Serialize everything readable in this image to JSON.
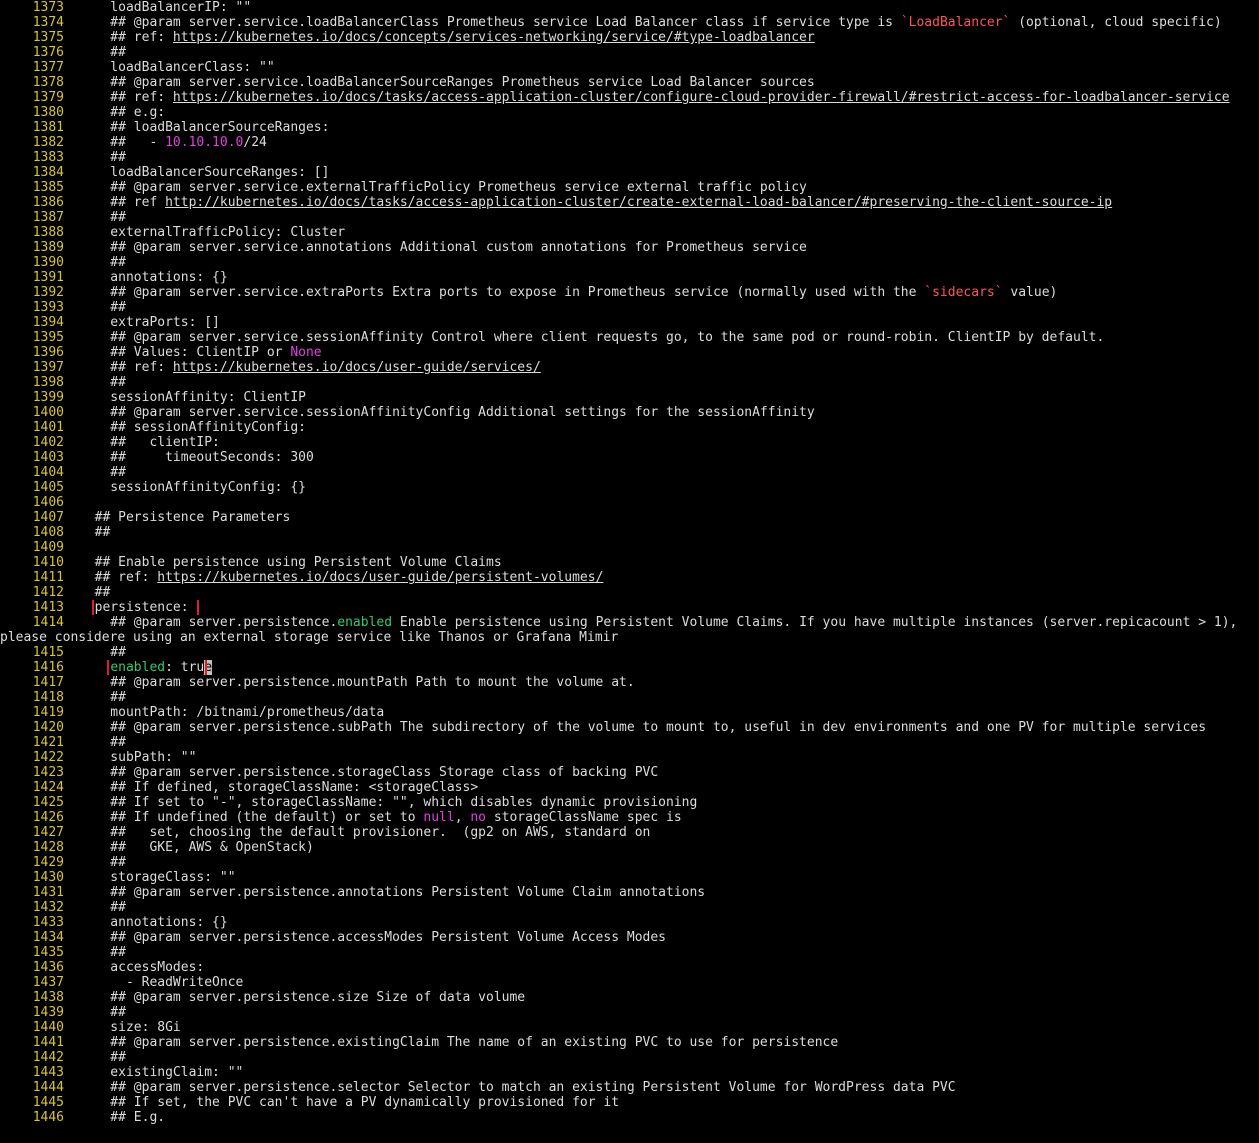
{
  "lines": [
    {
      "n": "1373",
      "segs": [
        {
          "t": "    loadBalancerIP: \"\""
        }
      ]
    },
    {
      "n": "1374",
      "segs": [
        {
          "t": "    ## @param server.service.loadBalancerClass Prometheus service Load Balancer class if service type is "
        },
        {
          "t": "`LoadBalancer`",
          "c": "redstr"
        },
        {
          "t": " (optional, cloud specific)"
        }
      ]
    },
    {
      "n": "1375",
      "segs": [
        {
          "t": "    ## ref: "
        },
        {
          "t": "https://kubernetes.io/docs/concepts/services-networking/service/#type-loadbalancer",
          "c": "link"
        }
      ]
    },
    {
      "n": "1376",
      "segs": [
        {
          "t": "    ##"
        }
      ]
    },
    {
      "n": "1377",
      "segs": [
        {
          "t": "    loadBalancerClass: \"\""
        }
      ]
    },
    {
      "n": "1378",
      "segs": [
        {
          "t": "    ## @param server.service.loadBalancerSourceRanges Prometheus service Load Balancer sources"
        }
      ]
    },
    {
      "n": "1379",
      "segs": [
        {
          "t": "    ## ref: "
        },
        {
          "t": "https://kubernetes.io/docs/tasks/access-application-cluster/configure-cloud-provider-firewall/#restrict-access-for-loadbalancer-service",
          "c": "link"
        }
      ]
    },
    {
      "n": "1380",
      "segs": [
        {
          "t": "    ## e.g:"
        }
      ]
    },
    {
      "n": "1381",
      "segs": [
        {
          "t": "    ## loadBalancerSourceRanges:"
        }
      ]
    },
    {
      "n": "1382",
      "segs": [
        {
          "t": "    ##   - "
        },
        {
          "t": "10.10.10.0",
          "c": "magenta"
        },
        {
          "t": "/24"
        }
      ]
    },
    {
      "n": "1383",
      "segs": [
        {
          "t": "    ##"
        }
      ]
    },
    {
      "n": "1384",
      "segs": [
        {
          "t": "    loadBalancerSourceRanges: []"
        }
      ]
    },
    {
      "n": "1385",
      "segs": [
        {
          "t": "    ## @param server.service.externalTrafficPolicy Prometheus service external traffic policy"
        }
      ]
    },
    {
      "n": "1386",
      "segs": [
        {
          "t": "    ## ref "
        },
        {
          "t": "http://kubernetes.io/docs/tasks/access-application-cluster/create-external-load-balancer/#preserving-the-client-source-ip",
          "c": "link"
        }
      ]
    },
    {
      "n": "1387",
      "segs": [
        {
          "t": "    ##"
        }
      ]
    },
    {
      "n": "1388",
      "segs": [
        {
          "t": "    externalTrafficPolicy: Cluster"
        }
      ]
    },
    {
      "n": "1389",
      "segs": [
        {
          "t": "    ## @param server.service.annotations Additional custom annotations for Prometheus service"
        }
      ]
    },
    {
      "n": "1390",
      "segs": [
        {
          "t": "    ##"
        }
      ]
    },
    {
      "n": "1391",
      "segs": [
        {
          "t": "    annotations: {}"
        }
      ]
    },
    {
      "n": "1392",
      "segs": [
        {
          "t": "    ## @param server.service.extraPorts Extra ports to expose in Prometheus service (normally used with the "
        },
        {
          "t": "`sidecars`",
          "c": "redstr"
        },
        {
          "t": " value)"
        }
      ]
    },
    {
      "n": "1393",
      "segs": [
        {
          "t": "    ##"
        }
      ]
    },
    {
      "n": "1394",
      "segs": [
        {
          "t": "    extraPorts: []"
        }
      ]
    },
    {
      "n": "1395",
      "segs": [
        {
          "t": "    ## @param server.service.sessionAffinity Control where client requests go, to the same pod or round-robin. ClientIP by default."
        }
      ]
    },
    {
      "n": "1396",
      "segs": [
        {
          "t": "    ## Values: ClientIP or "
        },
        {
          "t": "None",
          "c": "magenta"
        }
      ]
    },
    {
      "n": "1397",
      "segs": [
        {
          "t": "    ## ref: "
        },
        {
          "t": "https://kubernetes.io/docs/user-guide/services/",
          "c": "link"
        }
      ]
    },
    {
      "n": "1398",
      "segs": [
        {
          "t": "    ##"
        }
      ]
    },
    {
      "n": "1399",
      "segs": [
        {
          "t": "    sessionAffinity: ClientIP"
        }
      ]
    },
    {
      "n": "1400",
      "segs": [
        {
          "t": "    ## @param server.service.sessionAffinityConfig Additional settings for the sessionAffinity"
        }
      ]
    },
    {
      "n": "1401",
      "segs": [
        {
          "t": "    ## sessionAffinityConfig:"
        }
      ]
    },
    {
      "n": "1402",
      "segs": [
        {
          "t": "    ##   clientIP:"
        }
      ]
    },
    {
      "n": "1403",
      "segs": [
        {
          "t": "    ##     timeoutSeconds: 300"
        }
      ]
    },
    {
      "n": "1404",
      "segs": [
        {
          "t": "    ##"
        }
      ]
    },
    {
      "n": "1405",
      "segs": [
        {
          "t": "    sessionAffinityConfig: {}"
        }
      ]
    },
    {
      "n": "1406",
      "segs": [
        {
          "t": ""
        }
      ]
    },
    {
      "n": "1407",
      "segs": [
        {
          "t": "  ## Persistence Parameters"
        }
      ]
    },
    {
      "n": "1408",
      "segs": [
        {
          "t": "  ##"
        }
      ]
    },
    {
      "n": "1409",
      "segs": [
        {
          "t": ""
        }
      ]
    },
    {
      "n": "1410",
      "segs": [
        {
          "t": "  ## Enable persistence using Persistent Volume Claims"
        }
      ]
    },
    {
      "n": "1411",
      "segs": [
        {
          "t": "  ## ref: "
        },
        {
          "t": "https://kubernetes.io/docs/user-guide/persistent-volumes/",
          "c": "link"
        }
      ]
    },
    {
      "n": "1412",
      "segs": [
        {
          "t": "  ##"
        }
      ]
    },
    {
      "n": "1413",
      "segs": [
        {
          "t": "  "
        },
        {
          "t": "persistence: ",
          "c": "hl-box"
        }
      ]
    },
    {
      "n": "1414",
      "segs": [
        {
          "t": "    ## @param server.persistence."
        },
        {
          "t": "enabled",
          "c": "greenkey"
        },
        {
          "t": " Enable persistence using Persistent Volume Claims. If you have multiple instances (server.repicacount > 1),"
        }
      ]
    },
    {
      "n": "",
      "cont": true,
      "segs": [
        {
          "t": "please considere using an external storage service like Thanos or Grafana Mimir"
        }
      ]
    },
    {
      "n": "1415",
      "segs": [
        {
          "t": "    ##"
        }
      ]
    },
    {
      "n": "1416",
      "segs": [
        {
          "t": "    "
        },
        {
          "t": "enabled: tru",
          "c": "hl-box greenkey-start"
        },
        {
          "t": "e",
          "c": "cursor"
        }
      ]
    },
    {
      "n": "1417",
      "segs": [
        {
          "t": "    ## @param server.persistence.mountPath Path to mount the volume at."
        }
      ]
    },
    {
      "n": "1418",
      "segs": [
        {
          "t": "    ##"
        }
      ]
    },
    {
      "n": "1419",
      "segs": [
        {
          "t": "    mountPath: /bitnami/prometheus/data"
        }
      ]
    },
    {
      "n": "1420",
      "segs": [
        {
          "t": "    ## @param server.persistence.subPath The subdirectory of the volume to mount to, useful in dev environments and one PV for multiple services"
        }
      ]
    },
    {
      "n": "1421",
      "segs": [
        {
          "t": "    ##"
        }
      ]
    },
    {
      "n": "1422",
      "segs": [
        {
          "t": "    subPath: \"\""
        }
      ]
    },
    {
      "n": "1423",
      "segs": [
        {
          "t": "    ## @param server.persistence.storageClass Storage class of backing PVC"
        }
      ]
    },
    {
      "n": "1424",
      "segs": [
        {
          "t": "    ## If defined, storageClassName: <storageClass>"
        }
      ]
    },
    {
      "n": "1425",
      "segs": [
        {
          "t": "    ## If set to \"-\", storageClassName: \"\", which disables dynamic provisioning"
        }
      ]
    },
    {
      "n": "1426",
      "segs": [
        {
          "t": "    ## If undefined (the default) or set to "
        },
        {
          "t": "null",
          "c": "magenta"
        },
        {
          "t": ", "
        },
        {
          "t": "no",
          "c": "magenta"
        },
        {
          "t": " storageClassName spec is"
        }
      ]
    },
    {
      "n": "1427",
      "segs": [
        {
          "t": "    ##   set, choosing the default provisioner.  (gp2 on AWS, standard on"
        }
      ]
    },
    {
      "n": "1428",
      "segs": [
        {
          "t": "    ##   GKE, AWS & OpenStack)"
        }
      ]
    },
    {
      "n": "1429",
      "segs": [
        {
          "t": "    ##"
        }
      ]
    },
    {
      "n": "1430",
      "segs": [
        {
          "t": "    storageClass: \"\""
        }
      ]
    },
    {
      "n": "1431",
      "segs": [
        {
          "t": "    ## @param server.persistence.annotations Persistent Volume Claim annotations"
        }
      ]
    },
    {
      "n": "1432",
      "segs": [
        {
          "t": "    ##"
        }
      ]
    },
    {
      "n": "1433",
      "segs": [
        {
          "t": "    annotations: {}"
        }
      ]
    },
    {
      "n": "1434",
      "segs": [
        {
          "t": "    ## @param server.persistence.accessModes Persistent Volume Access Modes"
        }
      ]
    },
    {
      "n": "1435",
      "segs": [
        {
          "t": "    ##"
        }
      ]
    },
    {
      "n": "1436",
      "segs": [
        {
          "t": "    accessModes:"
        }
      ]
    },
    {
      "n": "1437",
      "segs": [
        {
          "t": "      - ReadWriteOnce"
        }
      ]
    },
    {
      "n": "1438",
      "segs": [
        {
          "t": "    ## @param server.persistence.size Size of data volume"
        }
      ]
    },
    {
      "n": "1439",
      "segs": [
        {
          "t": "    ##"
        }
      ]
    },
    {
      "n": "1440",
      "segs": [
        {
          "t": "    size: 8Gi"
        }
      ]
    },
    {
      "n": "1441",
      "segs": [
        {
          "t": "    ## @param server.persistence.existingClaim The name of an existing PVC to use for persistence"
        }
      ]
    },
    {
      "n": "1442",
      "segs": [
        {
          "t": "    ##"
        }
      ]
    },
    {
      "n": "1443",
      "segs": [
        {
          "t": "    existingClaim: \"\""
        }
      ]
    },
    {
      "n": "1444",
      "segs": [
        {
          "t": "    ## @param server.persistence.selector Selector to match an existing Persistent Volume for WordPress data PVC"
        }
      ]
    },
    {
      "n": "1445",
      "segs": [
        {
          "t": "    ## If set, the PVC can't have a PV dynamically provisioned for it"
        }
      ]
    },
    {
      "n": "1446",
      "segs": [
        {
          "t": "    ## E.g."
        }
      ]
    }
  ]
}
